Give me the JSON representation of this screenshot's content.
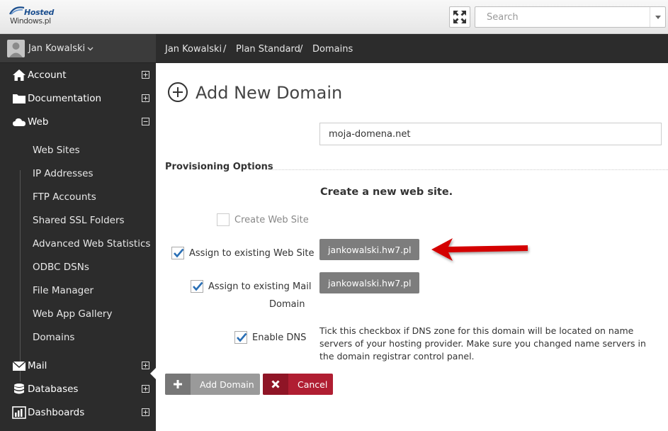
{
  "logo": {
    "line1": "Hosted",
    "line2": "Windows.pl"
  },
  "search": {
    "placeholder": "Search"
  },
  "user": {
    "name": "Jan Kowalski"
  },
  "sidebar": {
    "items": [
      {
        "label": "Account",
        "icon": "home-icon",
        "toggle": "plus"
      },
      {
        "label": "Documentation",
        "icon": "folder-icon",
        "toggle": "plus"
      },
      {
        "label": "Web",
        "icon": "cloud-icon",
        "toggle": "minus"
      }
    ],
    "web_sub_items": [
      "Web Sites",
      "IP Addresses",
      "FTP Accounts",
      "Shared SSL Folders",
      "Advanced Web Statistics",
      "ODBC DSNs",
      "File Manager",
      "Web App Gallery",
      "Domains"
    ],
    "bottom_items": [
      {
        "label": "Mail",
        "icon": "mail-icon",
        "toggle": "plus"
      },
      {
        "label": "Databases",
        "icon": "database-icon",
        "toggle": "plus"
      },
      {
        "label": "Dashboards",
        "icon": "chart-icon",
        "toggle": "plus"
      }
    ]
  },
  "breadcrumb": {
    "items": [
      "Jan Kowalski",
      "Plan Standard",
      "Domains"
    ],
    "separator": "/"
  },
  "main": {
    "title": "Add New Domain",
    "domain_value": "moja-domena.net",
    "section_heading": "Provisioning Options",
    "subtitle": "Create a new web site.",
    "create_web_site_label": "Create Web Site",
    "assign_web_label": "Assign to existing Web Site",
    "assign_web_value": "jankowalski.hw7.pl",
    "assign_mail_label_1": "Assign to existing Mail",
    "assign_mail_label_2": "Domain",
    "assign_mail_value": "jankowalski.hw7.pl",
    "enable_dns_label": "Enable DNS",
    "dns_help": "Tick this checkbox if DNS zone for this domain will be located on name servers of your hosting provider. Make sure you changed name servers in the domain registrar control panel.",
    "add_button": "Add Domain",
    "cancel_button": "Cancel"
  },
  "colors": {
    "sidebar_bg": "#2c2c2c",
    "cancel_red": "#b01e32",
    "annotation_arrow": "#d40000",
    "checkmark": "#2a6fb5"
  }
}
